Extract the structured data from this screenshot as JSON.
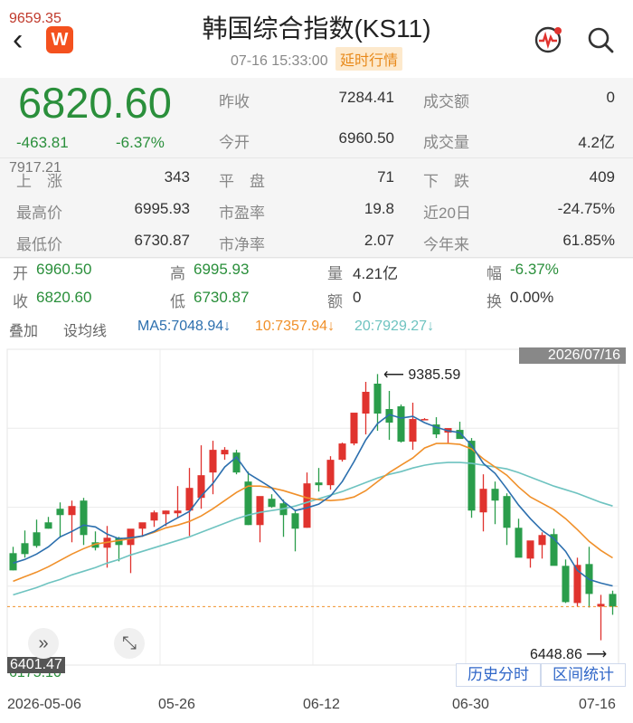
{
  "header": {
    "back_glyph": "‹",
    "logo_letter": "W",
    "title": "韩国综合指数(KS11)",
    "time": "07-16  15:33:00",
    "delay_tag": "延时行情",
    "icons": [
      "back-icon",
      "wind-logo-icon",
      "live-broadcast-icon",
      "search-icon"
    ]
  },
  "quote": {
    "price": "6820.60",
    "change": "-463.81",
    "change_pct": "-6.37%",
    "prev_close_label": "昨收",
    "prev_close": "7284.41",
    "turnover_label": "成交额",
    "turnover": "0",
    "open_label": "今开",
    "open": "6960.50",
    "volume_label": "成交量",
    "volume": "4.2亿",
    "up_label": "上　涨",
    "up": "343",
    "flat_label": "平　盘",
    "flat": "71",
    "down_label": "下　跌",
    "down": "409",
    "high_label": "最高价",
    "high": "6995.93",
    "pe_label": "市盈率",
    "pe": "19.8",
    "d20_label": "近20日",
    "d20": "-24.75%",
    "low_label": "最低价",
    "low": "6730.87",
    "pb_label": "市净率",
    "pb": "2.07",
    "ytd_label": "今年来",
    "ytd": "61.85%"
  },
  "ohlc": {
    "open_label": "开",
    "open": "6960.50",
    "high_label": "高",
    "high": "6995.93",
    "vol_label": "量",
    "vol": "4.21亿",
    "amp_label": "幅",
    "amp": "-6.37%",
    "close_label": "收",
    "close": "6820.60",
    "low_label": "低",
    "low": "6730.87",
    "amt_label": "额",
    "amt": "0",
    "turn_label": "换",
    "turn": "0.00%"
  },
  "toolbar": {
    "overlay": "叠加",
    "set_ma": "设均线",
    "ma5": "MA5:7048.94↓",
    "ma10": "10:7357.94↓",
    "ma20": "20:7929.27↓"
  },
  "colors": {
    "up": "#e0332e",
    "down": "#2a9d4b",
    "ma5": "#2c6fae",
    "ma10": "#f0902a",
    "ma20": "#6ec3c0",
    "accent": "#2f66c8"
  },
  "chart_data": {
    "type": "candlestick",
    "x": [
      "2026-05-06",
      "2026-05-07",
      "2026-05-08",
      "2026-05-11",
      "2026-05-12",
      "2026-05-13",
      "2026-05-14",
      "2026-05-15",
      "2026-05-18",
      "2026-05-19",
      "2026-05-20",
      "2026-05-21",
      "2026-05-22",
      "2026-05-25",
      "2026-05-26",
      "2026-05-27",
      "2026-05-28",
      "2026-05-29",
      "2026-06-01",
      "2026-06-02",
      "2026-06-03",
      "2026-06-04",
      "2026-06-05",
      "2026-06-08",
      "2026-06-09",
      "2026-06-10",
      "2026-06-11",
      "2026-06-12",
      "2026-06-15",
      "2026-06-16",
      "2026-06-17",
      "2026-06-18",
      "2026-06-19",
      "2026-06-22",
      "2026-06-23",
      "2026-06-24",
      "2026-06-25",
      "2026-06-26",
      "2026-06-29",
      "2026-06-30",
      "2026-07-01",
      "2026-07-02",
      "2026-07-03",
      "2026-07-06",
      "2026-07-07",
      "2026-07-08",
      "2026-07-09",
      "2026-07-10",
      "2026-07-13",
      "2026-07-14",
      "2026-07-15",
      "2026-07-16"
    ],
    "o": [
      7410,
      7520,
      7640,
      7750,
      7900,
      7830,
      7990,
      7530,
      7470,
      7580,
      7500,
      7680,
      7770,
      7840,
      7850,
      7880,
      8020,
      8300,
      8500,
      8520,
      8200,
      7720,
      8010,
      7960,
      7850,
      7690,
      8190,
      8160,
      8440,
      8620,
      8950,
      9280,
      9000,
      9030,
      8640,
      8890,
      8830,
      8740,
      8770,
      8650,
      7860,
      8120,
      8040,
      7690,
      7350,
      7500,
      7620,
      7270,
      6860,
      7290,
      6820,
      6960
    ],
    "h": [
      7480,
      7660,
      7780,
      7810,
      7970,
      7990,
      8020,
      7650,
      7710,
      7590,
      7580,
      7740,
      7880,
      7880,
      8150,
      8350,
      8600,
      8650,
      8580,
      8550,
      8310,
      8030,
      8060,
      8000,
      7890,
      8300,
      8350,
      8480,
      8630,
      8920,
      9300,
      9386,
      9200,
      9050,
      9070,
      8900,
      8910,
      8780,
      8860,
      8680,
      8280,
      8200,
      8070,
      7790,
      7500,
      7640,
      7680,
      7340,
      7360,
      7480,
      6950,
      6996
    ],
    "l": [
      7220,
      7360,
      7470,
      7680,
      7580,
      7530,
      7500,
      7440,
      7250,
      7320,
      7190,
      7590,
      7700,
      7710,
      7800,
      7600,
      7900,
      8060,
      8440,
      8280,
      7720,
      7530,
      7910,
      7590,
      7430,
      7690,
      8090,
      8110,
      8420,
      8600,
      8720,
      8760,
      8660,
      8630,
      8550,
      8880,
      8680,
      8620,
      8700,
      7800,
      7650,
      7730,
      7500,
      7380,
      7250,
      7350,
      7280,
      6860,
      6820,
      6810,
      6449,
      6730
    ],
    "c": [
      7220,
      7400,
      7490,
      7680,
      7830,
      7930,
      7610,
      7470,
      7580,
      7500,
      7680,
      7750,
      7860,
      7880,
      7880,
      8130,
      8270,
      8550,
      8550,
      8300,
      7720,
      8040,
      7920,
      7830,
      7680,
      8180,
      8160,
      8440,
      8620,
      8960,
      9190,
      8950,
      8850,
      8640,
      8890,
      8890,
      8720,
      8790,
      8670,
      7880,
      8120,
      7990,
      7690,
      7360,
      7550,
      7610,
      7270,
      6870,
      7280,
      6960,
      6850,
      6820
    ],
    "ma5": [
      7300,
      7340,
      7400,
      7480,
      7590,
      7650,
      7720,
      7700,
      7620,
      7570,
      7580,
      7600,
      7650,
      7730,
      7800,
      7870,
      8040,
      8180,
      8360,
      8470,
      8290,
      8210,
      8130,
      7980,
      7880,
      7910,
      7950,
      8040,
      8200,
      8420,
      8660,
      8840,
      8940,
      8900,
      8920,
      8850,
      8800,
      8760,
      8740,
      8600,
      8400,
      8290,
      8120,
      7940,
      7790,
      7660,
      7570,
      7430,
      7220,
      7120,
      7080,
      7049
    ],
    "ma10": [
      7100,
      7150,
      7200,
      7260,
      7330,
      7400,
      7460,
      7510,
      7530,
      7550,
      7570,
      7600,
      7640,
      7690,
      7720,
      7760,
      7820,
      7900,
      7990,
      8080,
      8150,
      8150,
      8130,
      8100,
      8060,
      8020,
      8000,
      7990,
      8000,
      8030,
      8100,
      8200,
      8300,
      8380,
      8460,
      8570,
      8620,
      8620,
      8610,
      8560,
      8450,
      8360,
      8270,
      8140,
      8030,
      7960,
      7890,
      7790,
      7670,
      7540,
      7440,
      7358
    ],
    "ma20": [
      6950,
      6990,
      7030,
      7080,
      7120,
      7170,
      7210,
      7250,
      7300,
      7340,
      7390,
      7430,
      7470,
      7510,
      7550,
      7590,
      7640,
      7690,
      7740,
      7790,
      7830,
      7860,
      7880,
      7900,
      7930,
      7970,
      8010,
      8050,
      8090,
      8140,
      8190,
      8240,
      8280,
      8310,
      8350,
      8380,
      8400,
      8410,
      8410,
      8400,
      8380,
      8360,
      8340,
      8300,
      8250,
      8200,
      8150,
      8110,
      8070,
      8020,
      7970,
      7930
    ],
    "y_top_label": "9659.35",
    "y_mid_label": "7917.21",
    "y_bottom_label": "6175.10",
    "ylim": [
      6175.1,
      9659.35
    ],
    "current_label": "6401.47",
    "max_label": "9385.59",
    "min_label": "6448.86",
    "date_tag": "2026/07/16",
    "x_labels": [
      "2026-05-06",
      "05-26",
      "06-12",
      "06-30",
      "07-16"
    ],
    "grid": true
  },
  "buttons": {
    "history": "历史分时",
    "stats": "区间统计",
    "expand_glyph": "»",
    "resize_glyph": "⤡"
  }
}
